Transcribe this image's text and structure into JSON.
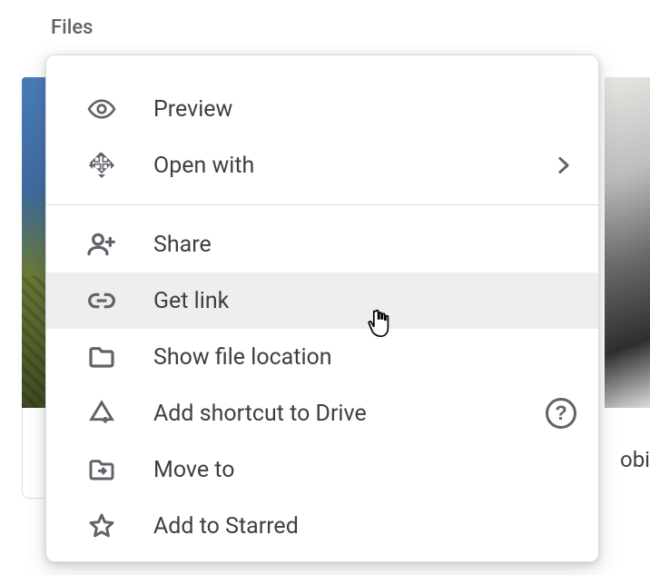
{
  "section_label": "Files",
  "menu": {
    "preview": "Preview",
    "open_with": "Open with",
    "share": "Share",
    "get_link": "Get link",
    "show_location": "Show file location",
    "add_shortcut": "Add shortcut to Drive",
    "move_to": "Move to",
    "add_starred": "Add to Starred"
  },
  "truncated_thumb_label": "obi"
}
